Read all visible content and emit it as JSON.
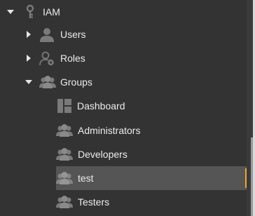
{
  "tree": {
    "iam": {
      "label": "IAM",
      "icon": "key-icon",
      "expanded": true
    },
    "users": {
      "label": "Users",
      "icon": "user-icon",
      "expanded": false
    },
    "roles": {
      "label": "Roles",
      "icon": "role-icon",
      "expanded": false
    },
    "groups": {
      "label": "Groups",
      "icon": "group-icon",
      "expanded": true
    },
    "dashboard": {
      "label": "Dashboard",
      "icon": "dashboard-icon"
    },
    "administrators": {
      "label": "Administrators",
      "icon": "group-icon"
    },
    "developers": {
      "label": "Developers",
      "icon": "group-icon"
    },
    "test": {
      "label": "test",
      "icon": "group-icon",
      "selected": true
    },
    "testers": {
      "label": "Testers",
      "icon": "group-icon"
    }
  },
  "colors": {
    "background": "#333333",
    "selected_background": "#555555",
    "selection_accent": "#f0a632",
    "icon": "#7a7a7a",
    "text": "#ececec"
  }
}
